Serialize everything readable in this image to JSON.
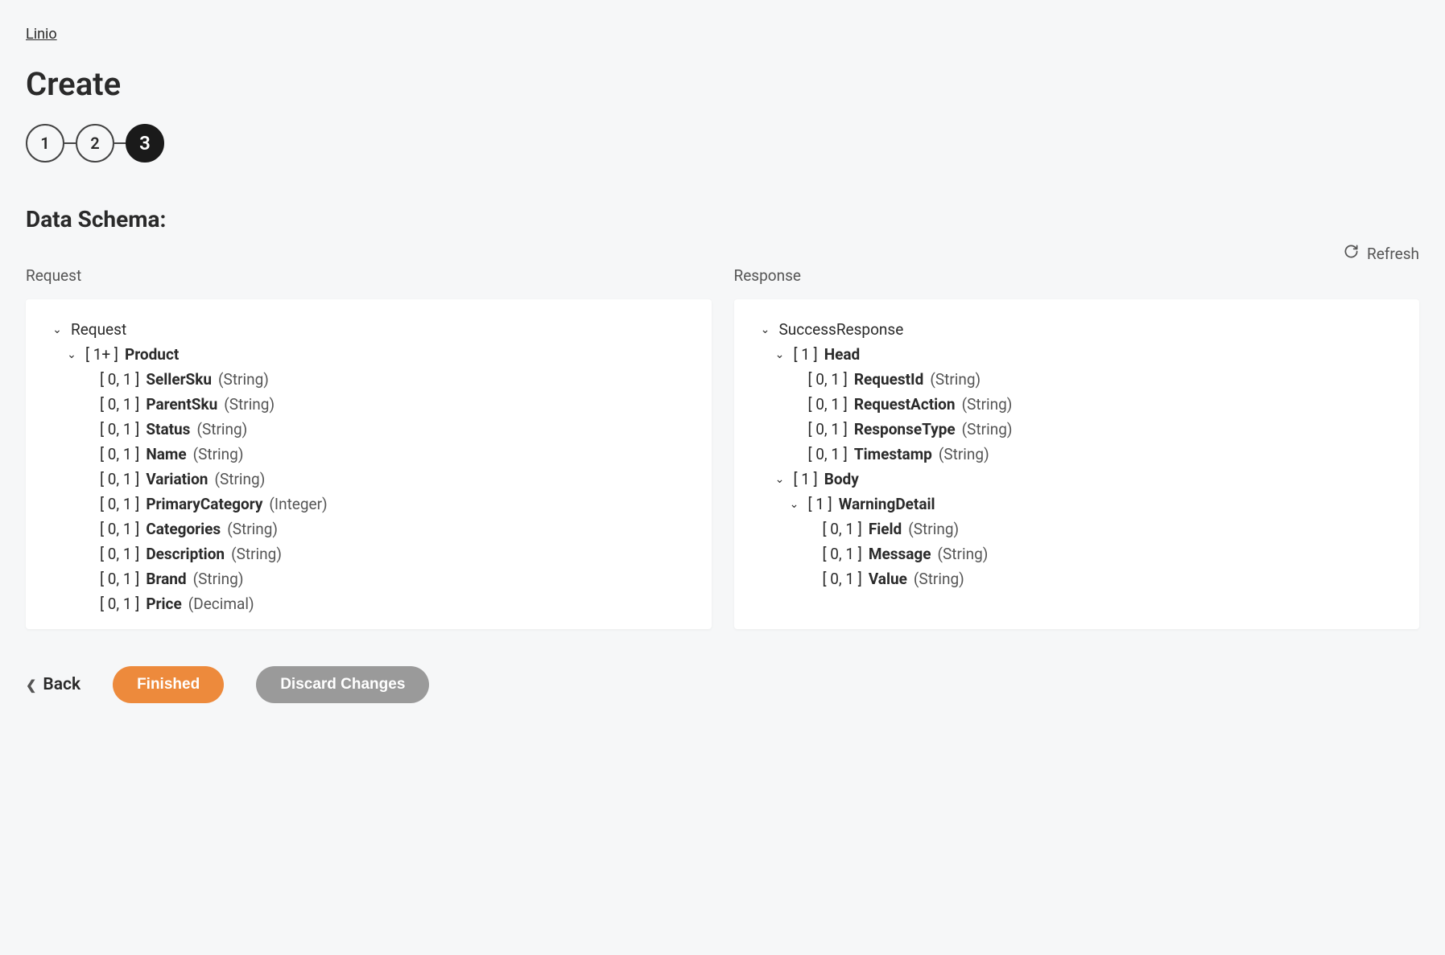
{
  "breadcrumb": "Linio",
  "page_title": "Create",
  "steps": [
    "1",
    "2",
    "3"
  ],
  "active_step_index": 2,
  "section_title": "Data Schema:",
  "refresh_label": "Refresh",
  "columns": {
    "request": {
      "label": "Request",
      "tree": [
        {
          "indent": 0,
          "chevron": true,
          "card": "",
          "name": "Request",
          "name_bold": false,
          "type": ""
        },
        {
          "indent": 1,
          "chevron": true,
          "card": "[ 1+ ]",
          "name": "Product",
          "name_bold": true,
          "type": ""
        },
        {
          "indent": 2,
          "chevron": false,
          "card": "[ 0, 1 ]",
          "name": "SellerSku",
          "name_bold": true,
          "type": "(String)"
        },
        {
          "indent": 2,
          "chevron": false,
          "card": "[ 0, 1 ]",
          "name": "ParentSku",
          "name_bold": true,
          "type": "(String)"
        },
        {
          "indent": 2,
          "chevron": false,
          "card": "[ 0, 1 ]",
          "name": "Status",
          "name_bold": true,
          "type": "(String)"
        },
        {
          "indent": 2,
          "chevron": false,
          "card": "[ 0, 1 ]",
          "name": "Name",
          "name_bold": true,
          "type": "(String)"
        },
        {
          "indent": 2,
          "chevron": false,
          "card": "[ 0, 1 ]",
          "name": "Variation",
          "name_bold": true,
          "type": "(String)"
        },
        {
          "indent": 2,
          "chevron": false,
          "card": "[ 0, 1 ]",
          "name": "PrimaryCategory",
          "name_bold": true,
          "type": "(Integer)"
        },
        {
          "indent": 2,
          "chevron": false,
          "card": "[ 0, 1 ]",
          "name": "Categories",
          "name_bold": true,
          "type": "(String)"
        },
        {
          "indent": 2,
          "chevron": false,
          "card": "[ 0, 1 ]",
          "name": "Description",
          "name_bold": true,
          "type": "(String)"
        },
        {
          "indent": 2,
          "chevron": false,
          "card": "[ 0, 1 ]",
          "name": "Brand",
          "name_bold": true,
          "type": "(String)"
        },
        {
          "indent": 2,
          "chevron": false,
          "card": "[ 0, 1 ]",
          "name": "Price",
          "name_bold": true,
          "type": "(Decimal)"
        }
      ]
    },
    "response": {
      "label": "Response",
      "tree": [
        {
          "indent": 0,
          "chevron": true,
          "card": "",
          "name": "SuccessResponse",
          "name_bold": false,
          "type": ""
        },
        {
          "indent": 1,
          "chevron": true,
          "card": "[ 1 ]",
          "name": "Head",
          "name_bold": true,
          "type": ""
        },
        {
          "indent": 2,
          "chevron": false,
          "card": "[ 0, 1 ]",
          "name": "RequestId",
          "name_bold": true,
          "type": "(String)"
        },
        {
          "indent": 2,
          "chevron": false,
          "card": "[ 0, 1 ]",
          "name": "RequestAction",
          "name_bold": true,
          "type": "(String)"
        },
        {
          "indent": 2,
          "chevron": false,
          "card": "[ 0, 1 ]",
          "name": "ResponseType",
          "name_bold": true,
          "type": "(String)"
        },
        {
          "indent": 2,
          "chevron": false,
          "card": "[ 0, 1 ]",
          "name": "Timestamp",
          "name_bold": true,
          "type": "(String)"
        },
        {
          "indent": 1,
          "chevron": true,
          "card": "[ 1 ]",
          "name": "Body",
          "name_bold": true,
          "type": ""
        },
        {
          "indent": 2,
          "chevron": true,
          "card": "[ 1 ]",
          "name": "WarningDetail",
          "name_bold": true,
          "type": ""
        },
        {
          "indent": 3,
          "chevron": false,
          "card": "[ 0, 1 ]",
          "name": "Field",
          "name_bold": true,
          "type": "(String)"
        },
        {
          "indent": 3,
          "chevron": false,
          "card": "[ 0, 1 ]",
          "name": "Message",
          "name_bold": true,
          "type": "(String)"
        },
        {
          "indent": 3,
          "chevron": false,
          "card": "[ 0, 1 ]",
          "name": "Value",
          "name_bold": true,
          "type": "(String)"
        }
      ]
    }
  },
  "footer": {
    "back": "Back",
    "finished": "Finished",
    "discard": "Discard Changes"
  }
}
